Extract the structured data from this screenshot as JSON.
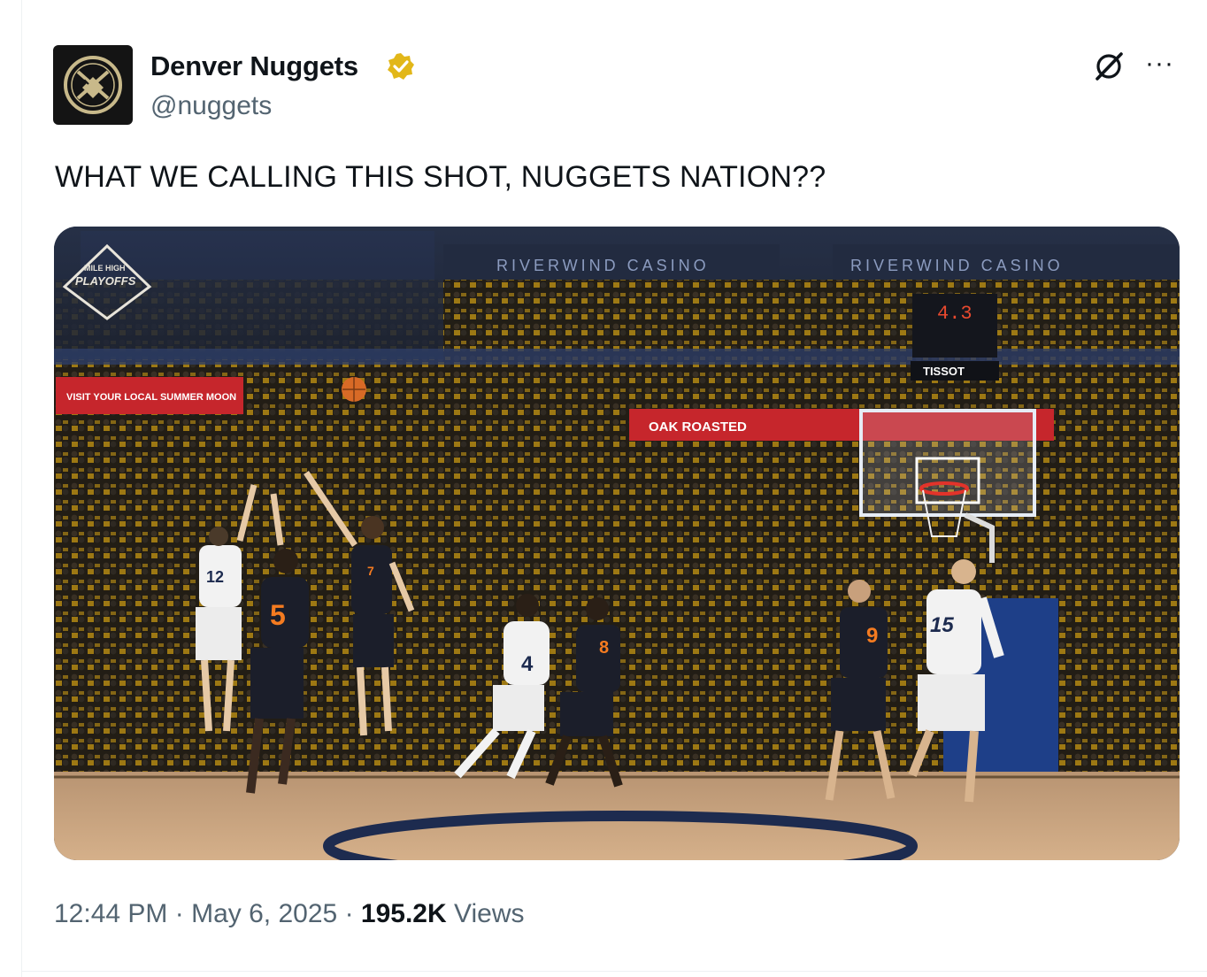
{
  "tweet": {
    "author_name": "Denver Nuggets",
    "author_handle": "@nuggets",
    "verified_icon": "verified-gold-badge-icon",
    "text": "WHAT WE CALLING THIS SHOT, NUGGETS NATION??",
    "time": "12:44 PM",
    "date": "May 6, 2025",
    "separator": "·",
    "views_count": "195.2K",
    "views_label": "Views",
    "more_icon": "···"
  },
  "media": {
    "playoffs_logo_top": "MILE HIGH",
    "playoffs_logo_main": "PLAYOFFS",
    "banner_left": "RIVERWIND CASINO",
    "banner_right": "RIVERWIND CASINO",
    "shot_clock": "4.3",
    "sponsor": "TISSOT",
    "ad_left": "VISIT YOUR LOCAL SUMMER MOON",
    "ad_mid": "OAK ROASTED",
    "players": [
      {
        "number": "12",
        "team": "nuggets"
      },
      {
        "number": "5",
        "team": "thunder"
      },
      {
        "number": "7",
        "team": "thunder"
      },
      {
        "number": "4",
        "team": "nuggets"
      },
      {
        "number": "8",
        "team": "thunder"
      },
      {
        "number": "9",
        "team": "thunder"
      },
      {
        "number": "15",
        "team": "nuggets"
      }
    ]
  },
  "colors": {
    "text_primary": "#0f1419",
    "text_secondary": "#536471",
    "badge_gold": "#e2b719",
    "thunder_jersey": "#1b1e2a",
    "thunder_accent": "#f47b20",
    "court": "#c89f74"
  }
}
